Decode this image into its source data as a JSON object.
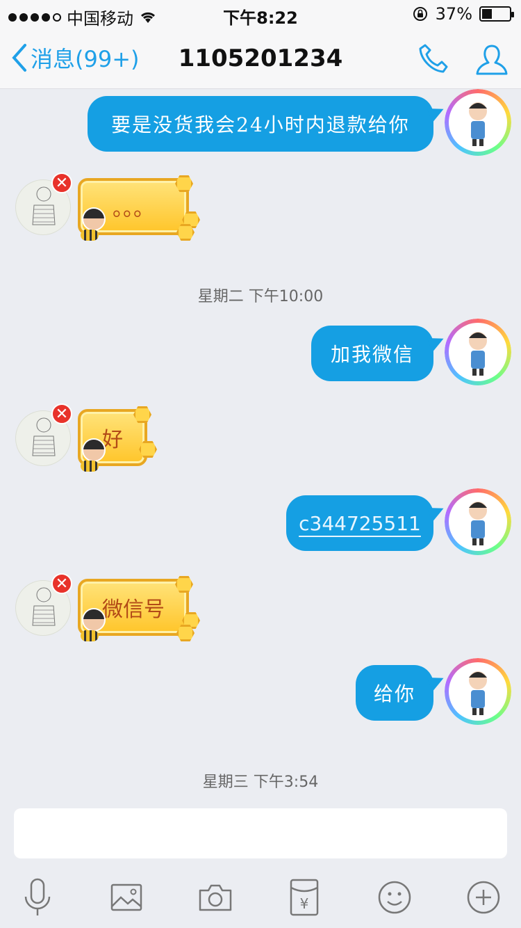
{
  "status_bar": {
    "carrier": "中国移动",
    "time": "下午8:22",
    "battery_percent": "37%",
    "battery_level": 0.37
  },
  "nav": {
    "back_label": "消息(99+)",
    "title": "1105201234",
    "accent_color": "#1fa0e8"
  },
  "messages": [
    {
      "side": "right",
      "text": "要是没货我会24小时内退款给你"
    },
    {
      "side": "left",
      "text": "。。。"
    },
    {
      "side": "time",
      "text": "星期二 下午10:00"
    },
    {
      "side": "right",
      "text": "加我微信"
    },
    {
      "side": "left",
      "text": "好"
    },
    {
      "side": "right",
      "text": "c344725511"
    },
    {
      "side": "left",
      "text": "微信号"
    },
    {
      "side": "right",
      "text": "给你"
    },
    {
      "side": "time",
      "text": "星期三 下午3:54"
    }
  ],
  "input": {
    "value": "",
    "placeholder": ""
  },
  "toolbar": {
    "icons": [
      "microphone-icon",
      "image-icon",
      "camera-icon",
      "red-packet-icon",
      "emoji-icon",
      "plus-icon"
    ],
    "red_packet_symbol": "¥"
  }
}
